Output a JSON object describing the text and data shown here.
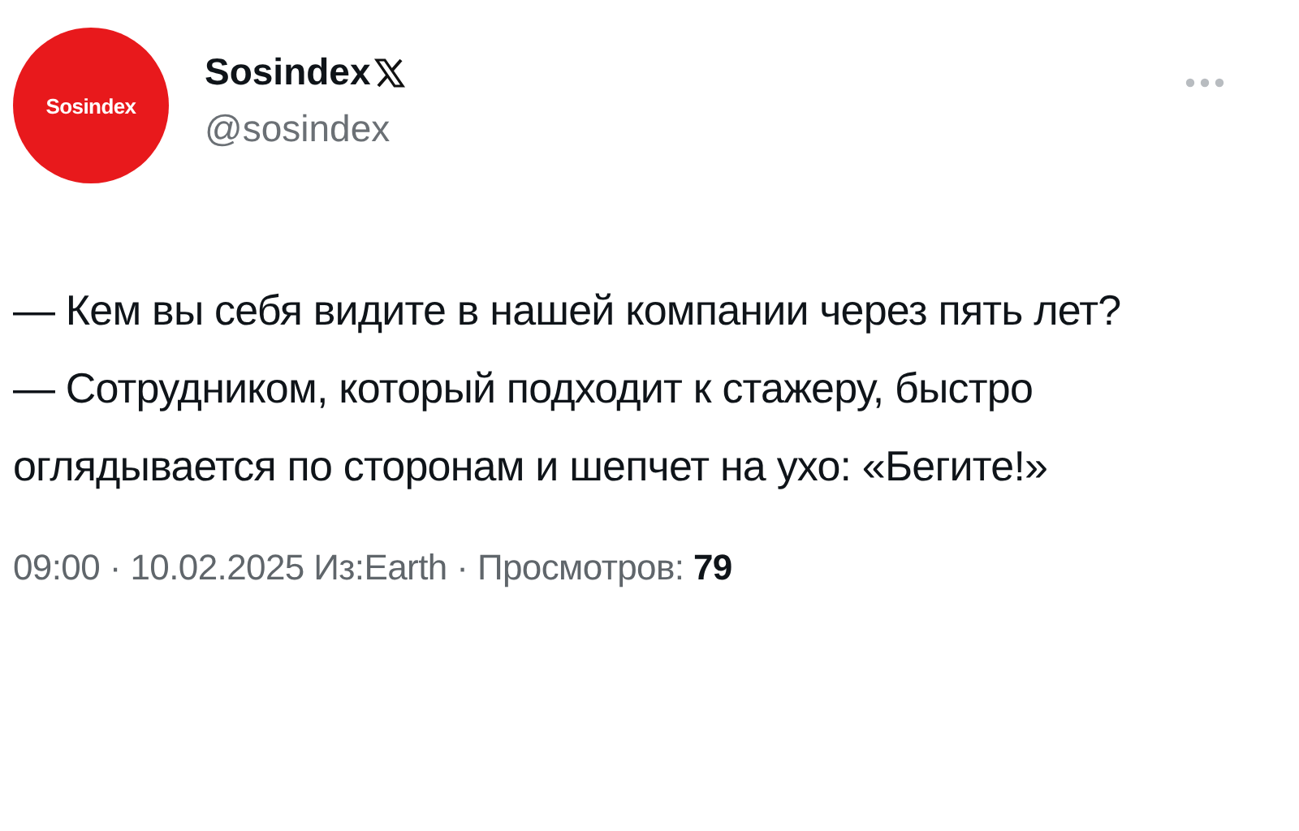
{
  "author": {
    "avatar_text": "Sosindex",
    "name": "Sosindex",
    "handle": "@sosindex"
  },
  "paragraphs": [
    "— Кем вы себя видите в нашей компании через пять лет?",
    "— Сотрудником, который подходит к стажеру, быстро оглядывается по сторонам и шепчет на ухо: «Бегите!»"
  ],
  "meta": "09:00 · 10.02.2025 Из:Earth · Просмотров: **79**"
}
